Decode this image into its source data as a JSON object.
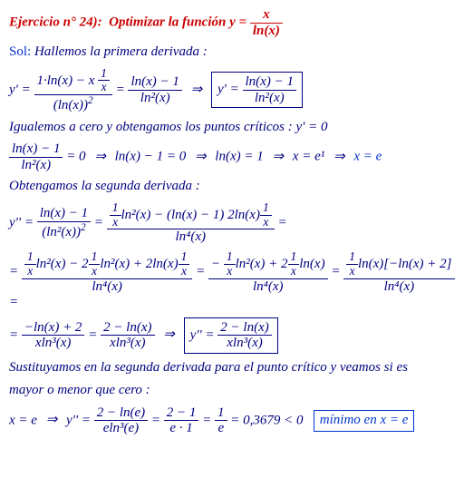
{
  "title_prefix": "Ejercicio n° 24):  Optimizar la función ",
  "title_eq": "y = ",
  "title_frac_num": "x",
  "title_frac_den": "ln(x)",
  "sol": "Sol:",
  "t1": " Hallemos la primera derivada :",
  "d1": {
    "lhs": "y' = ",
    "f1num": "1·ln(x) − x ",
    "f1num_inner_num": "1",
    "f1num_inner_den": "x",
    "f1den": "(ln(x))",
    "eq": " = ",
    "f2num": "ln(x) − 1",
    "f2den": "ln²(x)",
    "arr": "⇒",
    "boxlhs": "y' = ",
    "boxnum": "ln(x) − 1",
    "boxden": "ln²(x)"
  },
  "t2": "Igualemos a cero y obtengamos los puntos críticos : y' = 0",
  "d2": {
    "fnum": "ln(x) − 1",
    "fden": "ln²(x)",
    "eq0": " = 0",
    "arr": "⇒",
    "s1": "ln(x) − 1 = 0",
    "s2": "ln(x) = 1",
    "s3": "x = e¹",
    "s4": "x = e"
  },
  "t3": "Obtengamos la segunda derivada :",
  "d3a": {
    "lhs": "y'' = ",
    "f1num": "ln(x) − 1",
    "f1den": "(ln²(x))",
    "eq": " = ",
    "f2num_a_num": "1",
    "f2num_a_den": "x",
    "f2num_mid": "ln²(x) − (ln(x) − 1) 2ln(x)",
    "f2num_b_num": "1",
    "f2num_b_den": "x",
    "f2den": "ln⁴(x)",
    "trail": " ="
  },
  "d3b": {
    "eq_lead": "= ",
    "f1num_a_num": "1",
    "f1num_a_den": "x",
    "f1num_mid1": "ln²(x) − 2",
    "f1num_b_num": "1",
    "f1num_b_den": "x",
    "f1num_mid2": "ln²(x) + 2ln(x)",
    "f1num_c_num": "1",
    "f1num_c_den": "x",
    "f1den": "ln⁴(x)",
    "eq": " = ",
    "f2num_a_num": "1",
    "f2num_a_den": "x",
    "f2num_mid1": "ln²(x) + 2",
    "f2num_b_num": "1",
    "f2num_b_den": "x",
    "f2num_mid2": "ln(x)",
    "f2num_pre": "− ",
    "f2den": "ln⁴(x)",
    "f3num_a_num": "1",
    "f3num_a_den": "x",
    "f3num_tail": "ln(x)[−ln(x) + 2]",
    "f3den": "ln⁴(x)",
    "trail": " ="
  },
  "d3c": {
    "eq_lead": "= ",
    "f1num": "−ln(x) + 2",
    "f1den": "xln³(x)",
    "eq": " = ",
    "f2num": "2 − ln(x)",
    "f2den": "xln³(x)",
    "arr": "⇒",
    "boxlhs": "y'' = ",
    "boxnum": "2 − ln(x)",
    "boxden": "xln³(x)"
  },
  "t4a": "Sustituyamos en la segunda derivada para el punto crítico y veamos si es",
  "t4b": "mayor o menor que cero :",
  "d4": {
    "s0": "x = e",
    "arr": "⇒",
    "lhs": "y'' = ",
    "f1num": "2 − ln(e)",
    "f1den": "eln³(e)",
    "eq": " = ",
    "f2num": "2 − 1",
    "f2den": "e · 1",
    "f3num": "1",
    "f3den": "e",
    "tail": " = 0,3679 < 0",
    "box": "mínimo en x = e"
  }
}
